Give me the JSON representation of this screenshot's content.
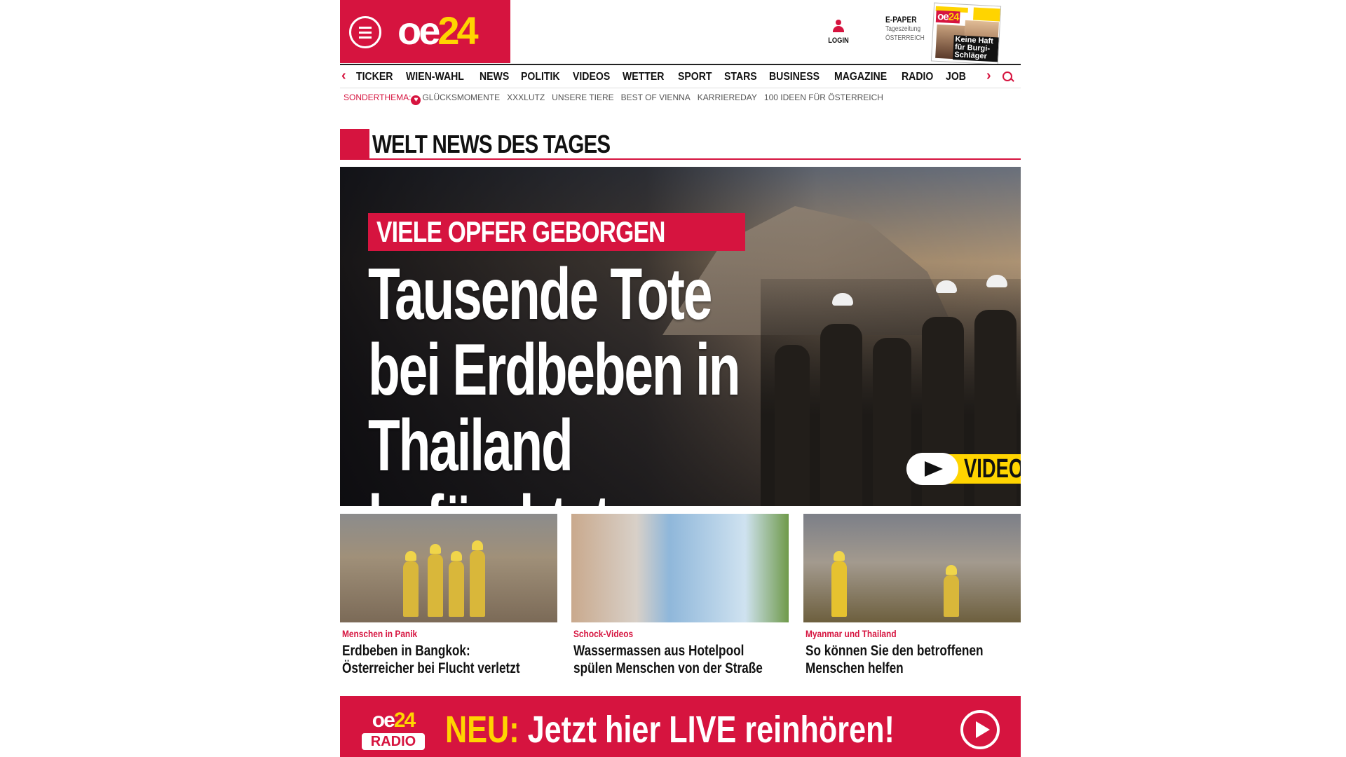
{
  "header": {
    "logo_oe": "oe",
    "logo_24": "24",
    "login_label": "LOGIN",
    "epaper": {
      "title": "E-PAPER",
      "line1": "Tageszeitung",
      "line2": "ÖSTERREICH"
    },
    "cover_teaser": "Keine Haft für Burgi-Schläger"
  },
  "nav": {
    "items": [
      "TICKER",
      "WIEN-WAHL",
      "NEWS",
      "POLITIK",
      "VIDEOS",
      "WETTER",
      "SPORT",
      "STARS",
      "BUSINESS",
      "MAGAZINE",
      "RADIO",
      "JOB"
    ]
  },
  "subnav": {
    "label": "SONDERTHEMA:",
    "items": [
      "GLÜCKSMOMENTE",
      "XXXLUTZ",
      "UNSERE TIERE",
      "BEST OF VIENNA",
      "KARRIEREDAY",
      "100 IDEEN FÜR ÖSTERREICH"
    ]
  },
  "section": {
    "title": "WELT NEWS DES TAGES"
  },
  "hero": {
    "kicker": "VIELE OPFER GEBORGEN",
    "headline_l1": "Tausende Tote",
    "headline_l2": "bei Erdbeben in",
    "headline_l3": "Thailand befürchtet",
    "video_label": "VIDEO"
  },
  "teasers": [
    {
      "kicker": "Menschen in Panik",
      "title": "Erdbeben in Bangkok: Österreicher bei Flucht verletzt"
    },
    {
      "kicker": "Schock-Videos",
      "title": "Wassermassen aus Hotelpool spülen Menschen von der Straße"
    },
    {
      "kicker": "Myanmar und Thailand",
      "title": "So können Sie den betroffenen Menschen helfen"
    }
  ],
  "radio": {
    "logo_oe": "oe",
    "logo_24": "24",
    "logo_word": "RADIO",
    "neu": "NEU:",
    "message": " Jetzt hier LIVE reinhören!"
  },
  "colors": {
    "brand_red": "#d6143f",
    "brand_yellow": "#ffd400"
  }
}
